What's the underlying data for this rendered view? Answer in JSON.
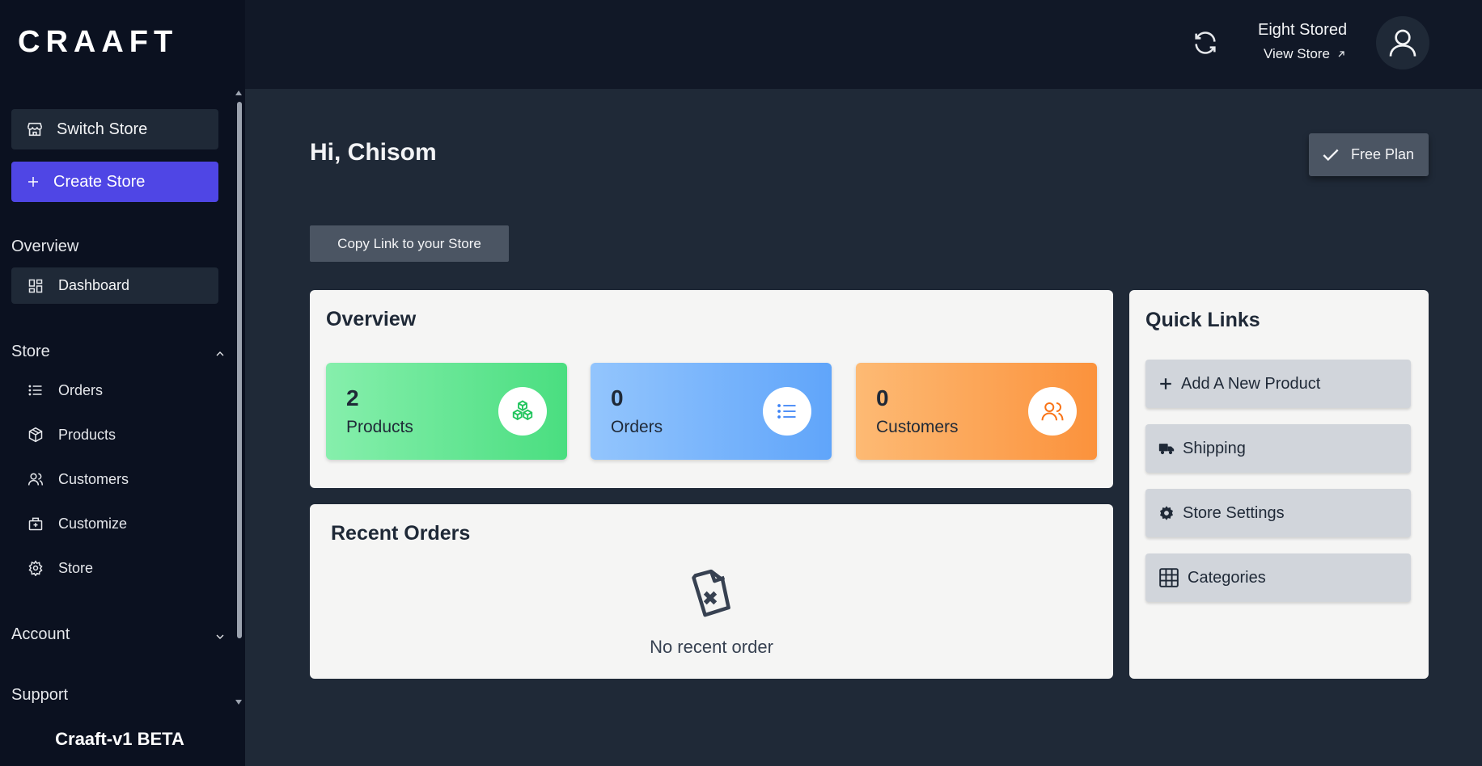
{
  "brand": {
    "logo_text": "CRAAFT",
    "version": "Craaft-v1 BETA"
  },
  "sidebar": {
    "switch_store": "Switch Store",
    "create_store": "Create Store",
    "overview_label": "Overview",
    "dashboard": "Dashboard",
    "store_label": "Store",
    "store_items": [
      "Orders",
      "Products",
      "Customers",
      "Customize",
      "Store"
    ],
    "account_label": "Account",
    "support_label": "Support"
  },
  "header": {
    "store_name": "Eight Stored",
    "view_store": "View Store"
  },
  "main": {
    "greeting": "Hi, Chisom",
    "plan": "Free Plan",
    "copy_link": "Copy Link to your Store",
    "overview_title": "Overview",
    "stats": [
      {
        "value": "2",
        "label": "Products",
        "icon": "cubes-icon",
        "color": "#22c55e"
      },
      {
        "value": "0",
        "label": "Orders",
        "icon": "list-icon",
        "color": "#3b82f6"
      },
      {
        "value": "0",
        "label": "Customers",
        "icon": "users-icon",
        "color": "#f97316"
      }
    ],
    "recent_title": "Recent Orders",
    "recent_empty": "No recent order",
    "quick_links_title": "Quick Links",
    "quick_links": [
      "Add A New Product",
      "Shipping",
      "Store Settings",
      "Categories"
    ]
  },
  "colors": {
    "accent": "#4f46e5",
    "sidebar_bg": "#0b1120",
    "main_bg": "#1f2937",
    "header_bg": "#111827"
  }
}
